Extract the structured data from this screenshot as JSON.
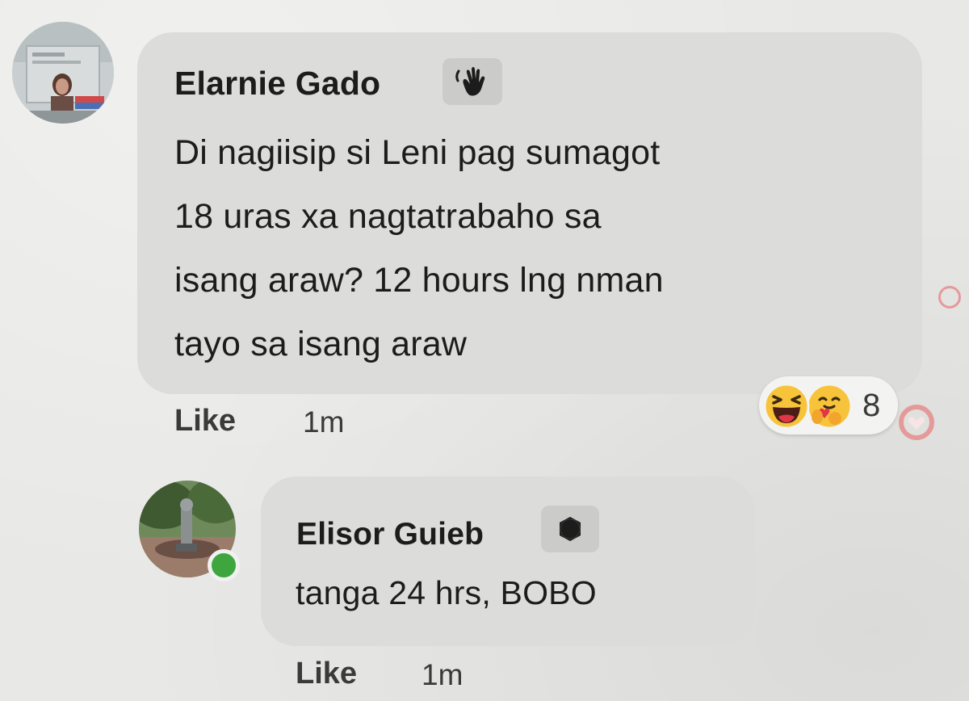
{
  "comments": [
    {
      "author": "Elarnie Gado",
      "badge_icon": "wave-hand-icon",
      "lines": [
        "Di nagiisip si Leni pag sumagot",
        "18 uras xa nagtatrabaho sa",
        "isang araw? 12 hours lng nman",
        "tayo sa isang araw"
      ],
      "like_label": "Like",
      "time": "1m",
      "reactions": {
        "icons": [
          "haha-reaction-icon",
          "care-reaction-icon"
        ],
        "count": "8"
      }
    },
    {
      "author": "Elisor Guieb",
      "badge_icon": "number-5-badge-icon",
      "text": "tanga 24 hrs, BOBO",
      "like_label": "Like",
      "time": "1m",
      "online": true
    }
  ],
  "colors": {
    "bubble": "#dcdcda",
    "background": "#e8e8e6",
    "online": "#3fa63f",
    "haha": "#f7c33a",
    "care_heart": "#e0364a"
  }
}
